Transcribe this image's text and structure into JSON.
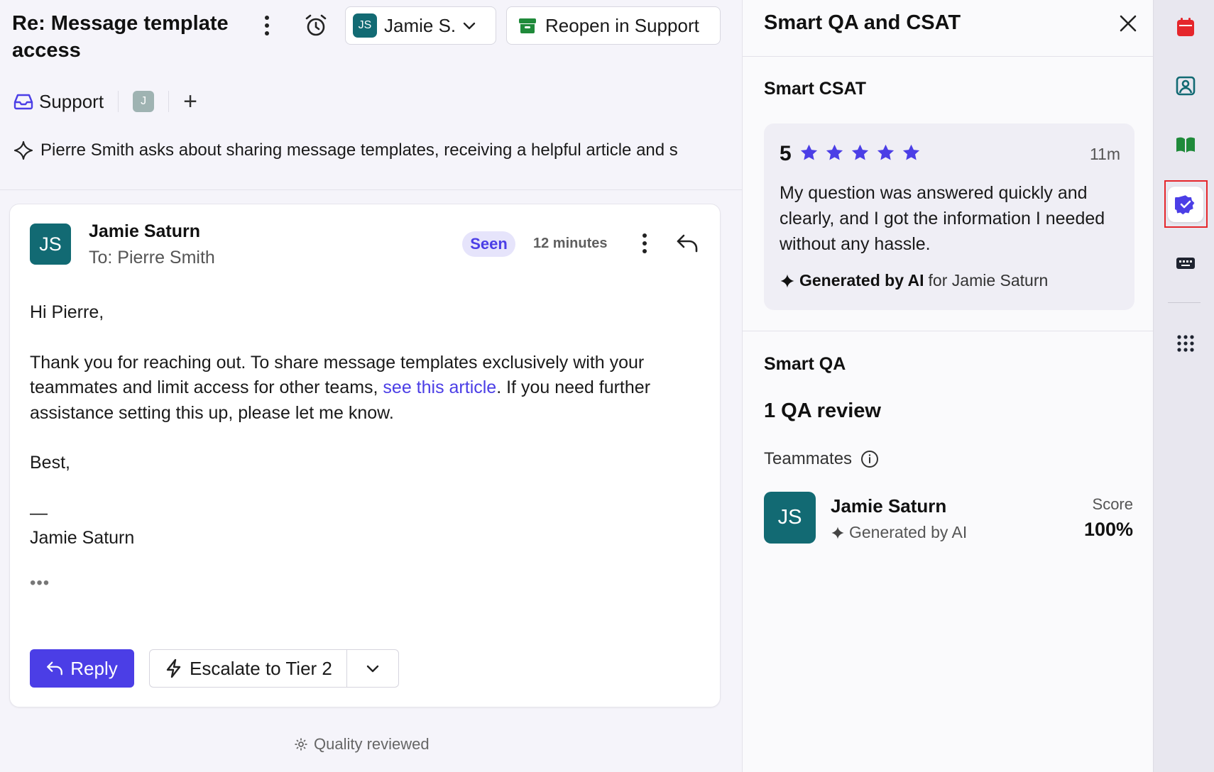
{
  "conversation": {
    "title": "Re: Message template access",
    "assignee": {
      "initials": "JS",
      "name": "Jamie S."
    },
    "reopen_label": "Reopen in Support",
    "inbox_label": "Support",
    "tag_initial": "J",
    "add_symbol": "+",
    "summary": "Pierre Smith asks about sharing message templates, receiving a helpful article and s"
  },
  "message": {
    "sender_initials": "JS",
    "sender": "Jamie Saturn",
    "to": "To: Pierre Smith",
    "seen": "Seen",
    "time": "12 minutes",
    "greeting": "Hi Pierre,",
    "para_before_link": "Thank you for reaching out. To share message templates exclusively with your teammates and limit access for other teams, ",
    "link_text": "see this article",
    "para_after_link": ". If you need further assistance setting this up, please let me know.",
    "signoff": "Best,",
    "dash": "—",
    "signature": "Jamie Saturn",
    "ellipsis": "•••",
    "reply_label": "Reply",
    "escalate_label": "Escalate to Tier 2"
  },
  "footer": {
    "quality": "Quality reviewed"
  },
  "panel": {
    "title": "Smart QA and CSAT",
    "csat_heading": "Smart CSAT",
    "csat_score": "5",
    "csat_stars": 5,
    "csat_ago": "11m",
    "csat_quote": "My question was answered quickly and clearly, and I got the information I needed without any hassle.",
    "generated_bold": "Generated by AI",
    "generated_for": "for Jamie Saturn",
    "qa_heading": "Smart QA",
    "qa_count": "1 QA review",
    "teammates_label": "Teammates",
    "teammate": {
      "initials": "JS",
      "name": "Jamie Saturn",
      "generated": "Generated by AI",
      "score_label": "Score",
      "score_value": "100%"
    }
  },
  "rail": {
    "icons": [
      "calendar-icon",
      "contact-card-icon",
      "book-icon",
      "verified-badge-icon",
      "keyboard-icon",
      "apps-grid-icon"
    ],
    "active": "verified-badge-icon"
  },
  "colors": {
    "accent": "#4b3ee6",
    "avatar_teal": "#126a73",
    "highlight_red": "#e5262b",
    "calendar_red": "#e5262b",
    "book_green": "#1f8a3a",
    "archive_green": "#1f8a3a"
  }
}
